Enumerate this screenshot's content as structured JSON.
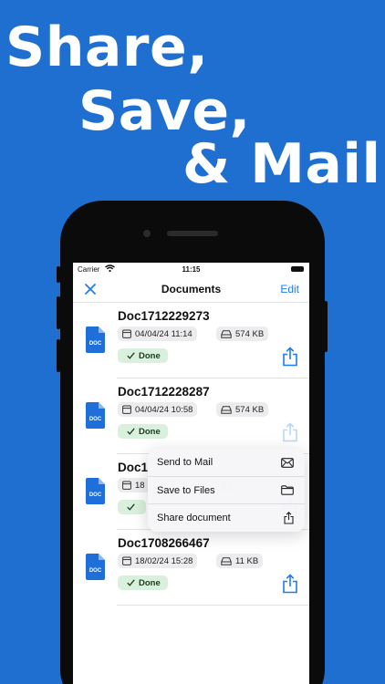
{
  "headline": {
    "line1": "Share,",
    "line2": "Save,",
    "line3": "& Mail"
  },
  "status_bar": {
    "carrier": "Carrier",
    "time": "11:15"
  },
  "nav": {
    "title": "Documents",
    "edit_label": "Edit"
  },
  "file_icon_label": "DOC",
  "documents": [
    {
      "name": "Doc1712229273",
      "date": "04/04/24 11:14",
      "size": "574 KB",
      "status": "Done"
    },
    {
      "name": "Doc1712228287",
      "date": "04/04/24 10:58",
      "size": "574 KB",
      "status": "Done"
    },
    {
      "name": "Doc1",
      "date": "18",
      "size": "",
      "status": ""
    },
    {
      "name": "Doc1708266467",
      "date": "18/02/24 15:28",
      "size": "11 KB",
      "status": "Done"
    }
  ],
  "context_menu": {
    "items": [
      {
        "label": "Send to Mail",
        "icon": "envelope-icon"
      },
      {
        "label": "Save to Files",
        "icon": "folder-icon"
      },
      {
        "label": "Share document",
        "icon": "share-icon"
      }
    ]
  },
  "colors": {
    "background": "#1f6fd0",
    "accent": "#1e7bf0",
    "file_icon": "#1e6fd9",
    "done_bg": "#d8f0dc"
  }
}
